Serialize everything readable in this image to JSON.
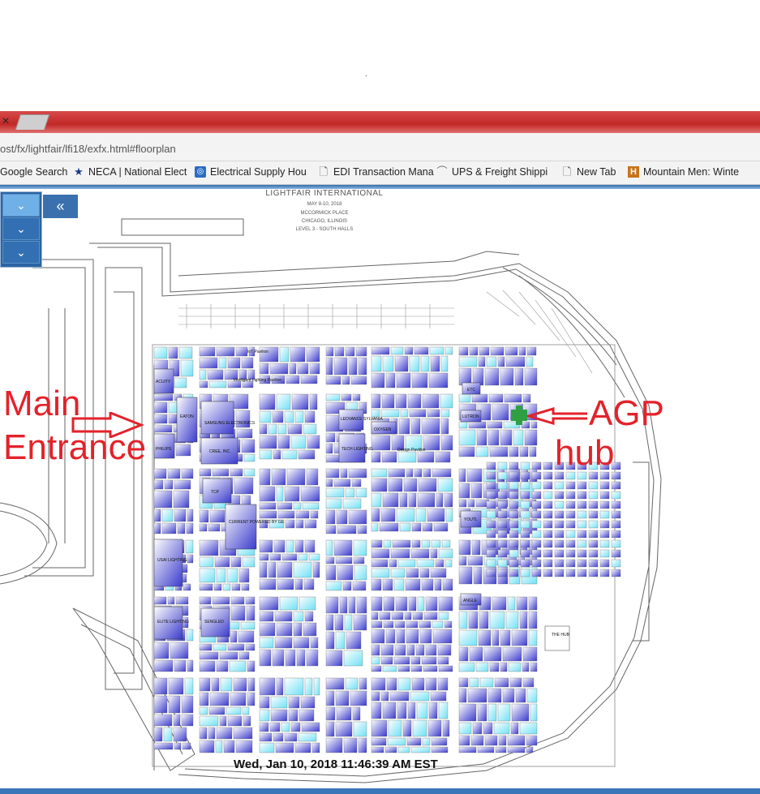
{
  "browser": {
    "tab_close": "×",
    "url": "ost/fx/lightfair/lfi18/exfx.html#floorplan",
    "bookmarks": [
      {
        "label": "Google Search",
        "icon": "none"
      },
      {
        "label": "NECA | National Elect",
        "icon": "star-icon"
      },
      {
        "label": "Electrical Supply Hou",
        "icon": "globe-icon"
      },
      {
        "label": "EDI Transaction Mana",
        "icon": "page-icon"
      },
      {
        "label": "UPS & Freight Shippi",
        "icon": "swoosh-icon"
      },
      {
        "label": "New Tab",
        "icon": "page-icon"
      },
      {
        "label": "Mountain Men: Winte",
        "icon": "history-icon"
      }
    ]
  },
  "panel": {
    "toggles": [
      "⌄",
      "⌄",
      "⌄"
    ],
    "collapse": "«"
  },
  "floorplan": {
    "title": "LIGHTFAIR  INTERNATIONAL",
    "date": "MAY 8-10, 2018",
    "venue": "MCCORMICK PLACE",
    "city": "CHICAGO, ILLINOIS",
    "level": "LEVEL 3 - SOUTH HALLS",
    "pavilions": {
      "iot": "IoT Pavilion",
      "intelligent": "Intelligent Lighting Pavilion",
      "design": "Design Pavilion"
    },
    "booths": {
      "acuity": "ACUITY",
      "eaton": "EATON",
      "philips": "PHILIPS",
      "samsung": "SAMSUNG ELECTRONICS",
      "cree": "CREE, INC.",
      "ledvance": "LEDVANCE SYLVANIA",
      "tech": "TECH LIGHTING",
      "oxygen": "OXYGEN",
      "tcp": "TCP",
      "current": "CURRENT POWERED BY GE",
      "usai": "USAI LIGHTING",
      "elite": "ELITE LIGHTING",
      "sengled": "SENGLED",
      "etc": "ETC",
      "lutron": "LUTRON",
      "youtl": "YOUTL",
      "angle": "ANGLE",
      "hub": "THE HUB"
    },
    "marker_color": "#2ea043",
    "booth_color_primary": "#3a3acc",
    "booth_color_secondary": "#6fe0f5"
  },
  "annotations": {
    "main": "Main",
    "entrance": "Entrance",
    "agp": "AGP",
    "hub": "hub",
    "color": "#e3222a"
  },
  "status": {
    "timestamp": "Wed, Jan 10, 2018 11:46:39 AM EST"
  }
}
